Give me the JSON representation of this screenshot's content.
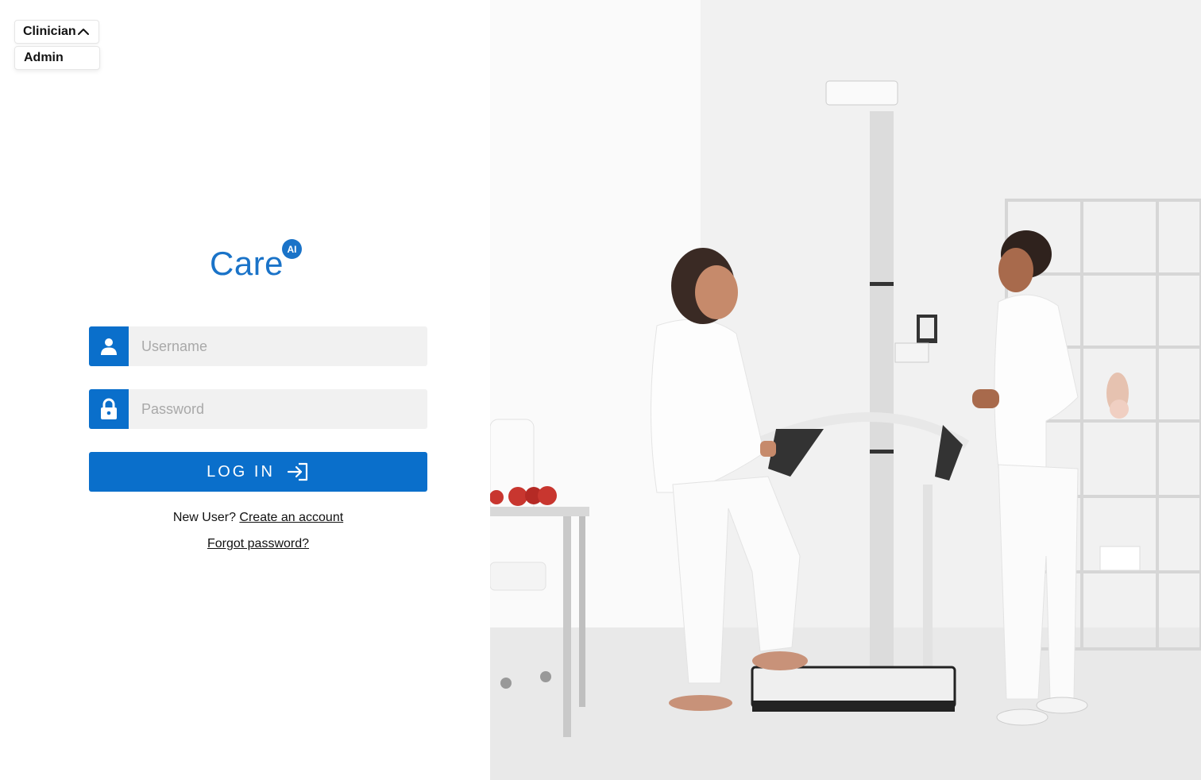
{
  "role_selector": {
    "selected": "Clinician",
    "options": [
      "Admin"
    ]
  },
  "logo": {
    "word": "Care",
    "badge": "AI"
  },
  "form": {
    "username_placeholder": "Username",
    "password_placeholder": "Password",
    "login_label": "LOG IN"
  },
  "links": {
    "new_user_prefix": "New User?",
    "create_account": "Create an account",
    "forgot_password": "Forgot password?"
  },
  "colors": {
    "brand": "#0a6fcb",
    "input_bg": "#f1f1f1"
  },
  "icons": {
    "username": "user-icon",
    "password": "lock-icon",
    "login": "sign-in-icon",
    "dropdown": "chevron-up-icon"
  }
}
